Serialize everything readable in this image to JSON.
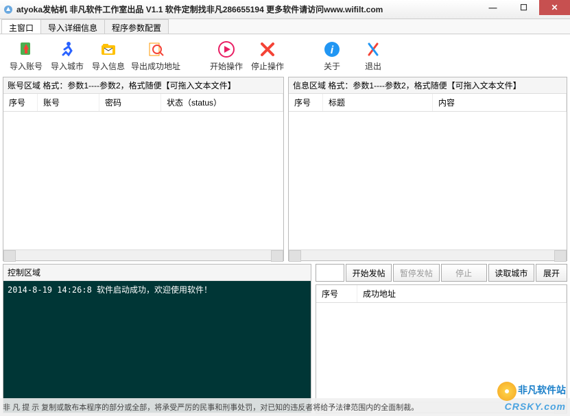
{
  "title": "atyoka发帖机 非凡软件工作室出品 V1.1   软件定制找非凡286655194 更多软件请访问www.wifilt.com",
  "tabs": [
    "主窗口",
    "导入详细信息",
    "程序参数配置"
  ],
  "toolbar": {
    "import_account": "导入账号",
    "import_city": "导入城市",
    "import_info": "导入信息",
    "export_success": "导出成功地址",
    "start": "开始操作",
    "stop": "停止操作",
    "about": "关于",
    "exit": "退出"
  },
  "account_panel": {
    "title": "账号区域  格式：参数1----参数2，格式随便【可拖入文本文件】",
    "headers": [
      "序号",
      "账号",
      "密码",
      "状态（status）"
    ]
  },
  "info_panel": {
    "title": "信息区域  格式：参数1----参数2，格式随便【可拖入文本文件】",
    "headers": [
      "序号",
      "标题",
      "内容"
    ]
  },
  "control_panel": {
    "title": "控制区域",
    "log": "2014-8-19 14:26:8  软件启动成功，欢迎使用软件！"
  },
  "actions": {
    "start_post": "开始发帖",
    "pause_post": "暂停发帖",
    "stop": "停止",
    "read_city": "读取城市",
    "expand": "展开"
  },
  "result_panel": {
    "headers": [
      "序号",
      "成功地址"
    ]
  },
  "footer_text": "非 凡 提 示 复制或散布本程序的部分或全部，将承受严厉的民事和刑事处罚，对已知的违反者将给予法律范围内的全面制裁。",
  "watermark": {
    "cn": "非凡软件站",
    "en": "CRSKY.com"
  }
}
